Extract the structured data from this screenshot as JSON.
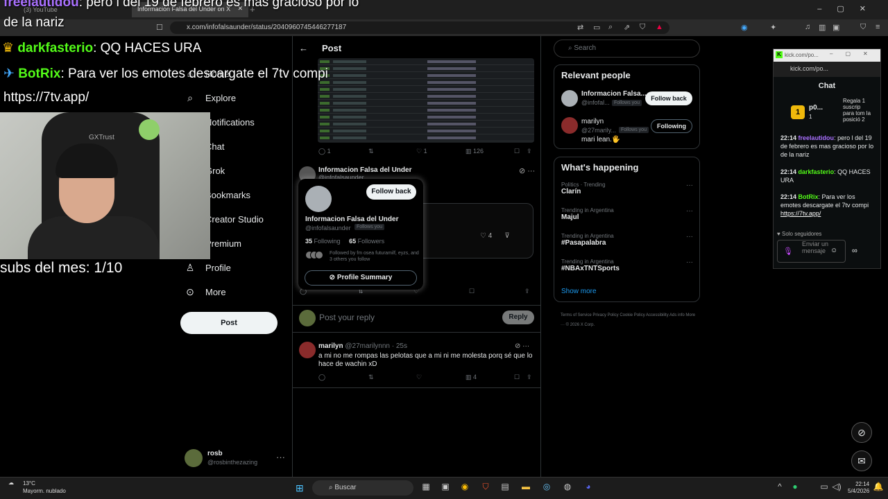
{
  "browser": {
    "tabs": [
      {
        "label": "(3) YouTube"
      },
      {
        "label": "Informacion Falsa del Under on X"
      }
    ],
    "url": "x.com/infofalsaunder/status/2040960745446277187"
  },
  "overlay": {
    "line1_user": "freelautidou",
    "line1_text": ": pero l del 19 de febrero es mas gracioso por lo",
    "line2": "de la nariz",
    "line3_user": "darkfasterio",
    "line3_text": ": QQ HACES URA",
    "line4_user": "BotRix",
    "line4_text": ": Para ver los emotes descargate el 7tv compi",
    "line5": "https://7tv.app/",
    "subs": "subs del mes: 1/10",
    "webcam_brand": "GXTrust"
  },
  "sidebar": {
    "items": [
      {
        "label": "Home",
        "icon": "home-icon"
      },
      {
        "label": "Explore",
        "icon": "search-icon"
      },
      {
        "label": "Notifications",
        "icon": "bell-icon"
      },
      {
        "label": "Chat",
        "icon": "chat-icon"
      },
      {
        "label": "Grok",
        "icon": "grok-icon"
      },
      {
        "label": "Bookmarks",
        "icon": "bookmark-icon"
      },
      {
        "label": "Creator Studio",
        "icon": "creator-icon"
      },
      {
        "label": "Premium",
        "icon": "premium-icon"
      },
      {
        "label": "Profile",
        "icon": "person-icon"
      },
      {
        "label": "More",
        "icon": "more-icon"
      }
    ],
    "post_button": "Post",
    "account": {
      "name": "rosb",
      "handle": "@rosbinthezazing"
    }
  },
  "post": {
    "header": "Post",
    "actions": {
      "replies": "1",
      "likes": "1",
      "views": "126"
    },
    "reply": {
      "author": "Informacion Falsa del Under",
      "handle": "@infofalsaunder",
      "likes": "4"
    },
    "reply_box": {
      "placeholder": "Post your reply",
      "button": "Reply"
    },
    "comment": {
      "author": "marilyn",
      "handle": "@27marilynnn",
      "time": "· 25s",
      "text": "a mi no me rompas las pelotas que a mi ni me molesta porq sé que lo hace de wachin xD",
      "views": "4"
    }
  },
  "hovercard": {
    "button": "Follow back",
    "name": "Informacion Falsa del Under",
    "handle": "@infofalsaunder",
    "follows_you": "Follows you",
    "following_count": "35",
    "following_label": "Following",
    "followers_count": "65",
    "followers_label": "Followers",
    "followed_by": "Followed by fm osea futuramilf, eyzs, and 3 others you follow",
    "profile_summary": "Profile Summary"
  },
  "right": {
    "search_placeholder": "Search",
    "relevant_title": "Relevant people",
    "people": [
      {
        "name": "Informacion Falsa...",
        "handle": "@infofal...",
        "badge": "Follows you",
        "button": "Follow back"
      },
      {
        "name": "marilyn",
        "handle": "@27marily...",
        "badge": "Follows you",
        "bio": "mari lean.🖐",
        "button": "Following"
      }
    ],
    "happening_title": "What's happening",
    "trends": [
      {
        "category": "Politics · Trending",
        "name": "Clarín"
      },
      {
        "category": "Trending in Argentina",
        "name": "Majul"
      },
      {
        "category": "Trending in Argentina",
        "name": "#Pasapalabra"
      },
      {
        "category": "Trending in Argentina",
        "name": "#NBAxTNTSports"
      }
    ],
    "show_more": "Show more",
    "footer": "Terms of Service   Privacy Policy   Cookie Policy   Accessibility   Ads info   More ···   © 2026 X Corp."
  },
  "kick": {
    "title": "kick.com/po...",
    "address": "kick.com/po...",
    "chat_title": "Chat",
    "gift_user": "p0...",
    "gift_count": "1",
    "gift_text": "Regala 1 suscrip para tom la posició 2",
    "messages": [
      {
        "time": "22:14",
        "user": "freelautidou",
        "text": ": pero l del 19 de febrero es mas gracioso por lo de la nariz"
      },
      {
        "time": "22:14",
        "user": "darkfasterio",
        "text": ": QQ HACES URA"
      },
      {
        "time": "22:14",
        "user": "BotRix",
        "text": ": Para ver los emotes descargate el 7tv compi",
        "link": "https://7tv.app/"
      }
    ],
    "solo": "Solo seguidores",
    "input_placeholder": "Enviar un mensaje"
  },
  "taskbar": {
    "temp": "13°C",
    "condition": "Mayorm. nublado",
    "search": "Buscar",
    "time": "22:14",
    "date": "5/4/2026"
  }
}
